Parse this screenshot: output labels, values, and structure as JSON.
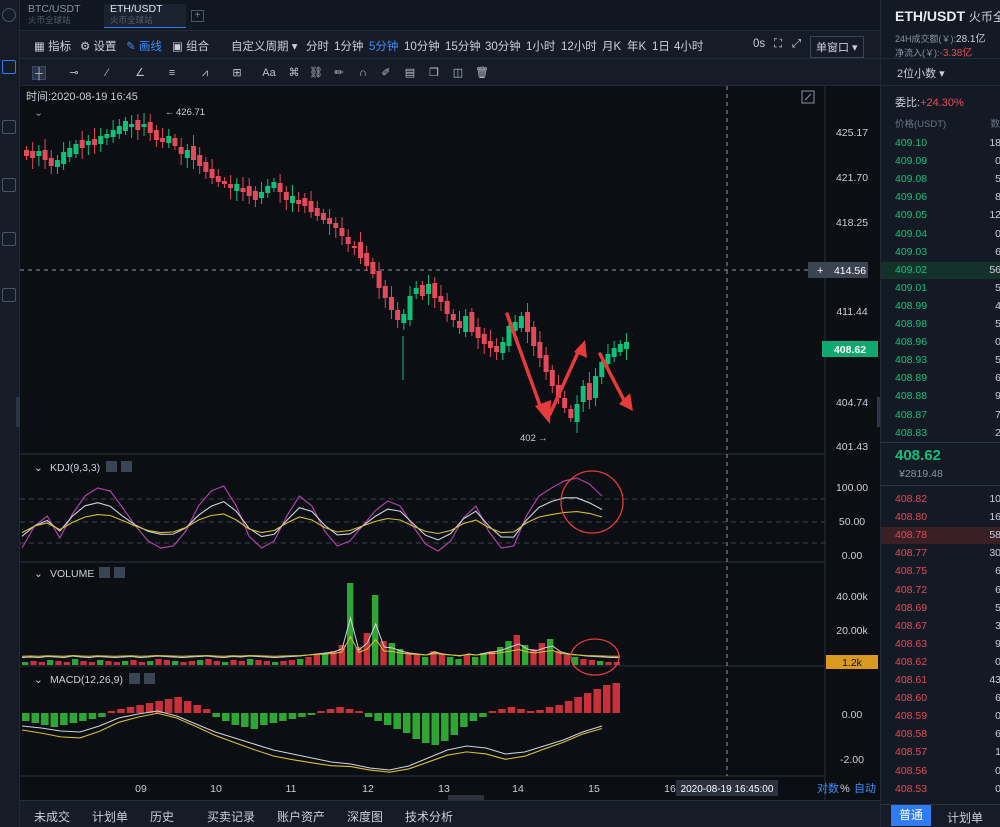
{
  "tabs": [
    {
      "label": "BTC/USDT",
      "sub": "火币全球站"
    },
    {
      "label": "ETH/USDT",
      "sub": "火币全球站"
    }
  ],
  "toolbar": {
    "indicators": "指标",
    "settings": "设置",
    "drawing": "画线",
    "combo": "组合",
    "custom_period": "自定义周期",
    "periods": [
      "分时",
      "1分钟",
      "5分钟",
      "10分钟",
      "15分钟",
      "30分钟",
      "1小时",
      "12小时",
      "月K",
      "年K",
      "1日",
      "4小时"
    ],
    "active_period": "5分钟",
    "zero_s": "0s",
    "window_mode": "单窗口"
  },
  "draw_tools": {
    "text_tool": "Aa"
  },
  "chart_header": {
    "time_label": "时间:2020-08-19 16:45"
  },
  "price_axis": [
    "425.17",
    "421.70",
    "418.25",
    "414.56",
    "411.44",
    "408.62",
    "404.74",
    "401.43"
  ],
  "price_markers": {
    "high": "426.71",
    "low": "402",
    "crosshair_price": "414.56",
    "current_price": "408.62"
  },
  "kdj": {
    "label": "KDJ(9,3,3)",
    "ticks": [
      "100.00",
      "50.00",
      "0.00"
    ]
  },
  "volume": {
    "label": "VOLUME",
    "ticks": [
      "40.00k",
      "20.00k"
    ],
    "current": "1.2k"
  },
  "macd": {
    "label": "MACD(12,26,9)",
    "ticks": [
      "0.00",
      "-2.00"
    ]
  },
  "time_axis": [
    "09",
    "10",
    "11",
    "12",
    "13",
    "14",
    "15",
    "16"
  ],
  "crosshair_time": "2020-08-19 16:45:00",
  "axis_controls": {
    "log": "对数",
    "percent": "%",
    "auto": "自动"
  },
  "bottom_tabs": [
    "未成交",
    "计划单",
    "历史",
    "买卖记录",
    "账户资产",
    "深度图",
    "技术分析"
  ],
  "right": {
    "pair": "ETH/USDT",
    "exchange": "火币全",
    "vol24_label": "24H成交额(￥):",
    "vol24": "28.1亿",
    "netflow_label": "净流入(￥):",
    "netflow": "-3.38亿",
    "precision": "2位小数",
    "ratio_label": "委比:",
    "ratio": "+24.30%",
    "col_price": "价格(USDT)",
    "col_qty": "数",
    "bids": [
      {
        "p": "409.10",
        "q": "18"
      },
      {
        "p": "409.09",
        "q": "0"
      },
      {
        "p": "409.08",
        "q": "5"
      },
      {
        "p": "409.06",
        "q": "8"
      },
      {
        "p": "409.05",
        "q": "12"
      },
      {
        "p": "409.04",
        "q": "0"
      },
      {
        "p": "409.03",
        "q": "6"
      },
      {
        "p": "409.02",
        "q": "56"
      },
      {
        "p": "409.01",
        "q": "5"
      },
      {
        "p": "408.99",
        "q": "4"
      },
      {
        "p": "408.98",
        "q": "5"
      },
      {
        "p": "408.96",
        "q": "0"
      },
      {
        "p": "408.93",
        "q": "5"
      },
      {
        "p": "408.89",
        "q": "6"
      },
      {
        "p": "408.88",
        "q": "9"
      },
      {
        "p": "408.87",
        "q": "7"
      },
      {
        "p": "408.83",
        "q": "2"
      }
    ],
    "last_price": "408.62",
    "last_cny": "¥2819.48",
    "asks": [
      {
        "p": "408.82",
        "q": "10"
      },
      {
        "p": "408.80",
        "q": "16"
      },
      {
        "p": "408.78",
        "q": "58"
      },
      {
        "p": "408.77",
        "q": "30"
      },
      {
        "p": "408.75",
        "q": "6"
      },
      {
        "p": "408.72",
        "q": "6"
      },
      {
        "p": "408.69",
        "q": "5"
      },
      {
        "p": "408.67",
        "q": "3"
      },
      {
        "p": "408.63",
        "q": "9"
      },
      {
        "p": "408.62",
        "q": "0"
      },
      {
        "p": "408.61",
        "q": "43"
      },
      {
        "p": "408.60",
        "q": "6"
      },
      {
        "p": "408.59",
        "q": "0"
      },
      {
        "p": "408.58",
        "q": "6"
      },
      {
        "p": "408.57",
        "q": "1"
      },
      {
        "p": "408.56",
        "q": "0"
      },
      {
        "p": "408.53",
        "q": "0"
      }
    ],
    "bottom_tabs": [
      "普通",
      "计划单"
    ]
  }
}
